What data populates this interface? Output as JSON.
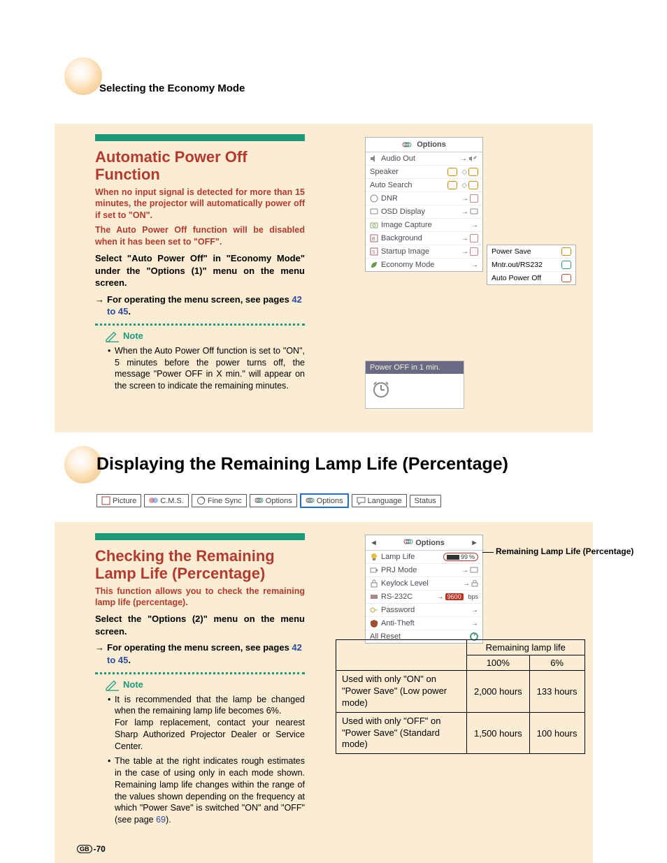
{
  "header": {
    "title": "Selecting the Economy Mode"
  },
  "section1": {
    "heading": "Automatic Power Off Function",
    "red1": "When no input signal is detected for more than 15 minutes, the projector will automatically power off if set to \"ON\".",
    "red2": "The Auto Power Off function will be disabled when it has been set to \"OFF\".",
    "bold": "Select \"Auto Power Off\" in \"Economy Mode\" under the \"Options (1)\" menu on the menu screen.",
    "arrowtext": "For operating the menu screen, see pages ",
    "arrowlink": "42 to 45",
    "arrowtail": ".",
    "note_label": "Note",
    "note_bullet": "When the Auto Power Off function is set to \"ON\", 5 minutes before the power turns off, the message \"Power OFF in X min.\" will appear on the screen to indicate the remaining minutes."
  },
  "osd1": {
    "title": "Options",
    "rows": [
      "Audio Out",
      "Speaker",
      "Auto Search",
      "DNR",
      "OSD Display",
      "Image Capture",
      "Background",
      "Startup Image",
      "Economy Mode"
    ]
  },
  "popout": {
    "rows": [
      "Power Save",
      "Mntr.out/RS232",
      "Auto Power Off"
    ]
  },
  "poweroff_msg": "Power OFF in 1 min.",
  "big_heading": "Displaying the Remaining Lamp Life (Percentage)",
  "tabs": [
    "Picture",
    "C.M.S.",
    "Fine Sync",
    "Options",
    "Options",
    "Language",
    "Status"
  ],
  "section2": {
    "heading": "Checking the Remaining Lamp Life (Percentage)",
    "red": "This function allows you to check the remaining lamp life (percentage).",
    "bold": "Select the \"Options (2)\" menu on the menu screen.",
    "arrowtext": "For operating the menu screen, see pages ",
    "arrowlink": "42 to 45",
    "arrowtail": ".",
    "note_label": "Note",
    "bullet1a": "It is recommended that the lamp be changed when the remaining lamp life becomes 6%.",
    "bullet1b": "For lamp replacement, contact your nearest Sharp Authorized Projector Dealer or Service Center.",
    "bullet2a": "The table at the right indicates rough estimates in the case of using only in each mode shown. Remaining lamp life changes within the range of the values shown depending on the frequency at which \"Power Save\" is switched \"ON\" and \"OFF\" (see page ",
    "bullet2link": "69",
    "bullet2tail": ")."
  },
  "osd2": {
    "title": "Options",
    "lamp_value": "99",
    "lamp_pct": "%",
    "rows": [
      "Lamp Life",
      "PRJ Mode",
      "Keylock Level",
      "RS-232C",
      "Password",
      "Anti-Theft",
      "All Reset"
    ],
    "bps": "9600",
    "bps_label": "bps"
  },
  "callout": "Remaining Lamp Life (Percentage)",
  "table": {
    "head_span": "Remaining lamp life",
    "col1": "100%",
    "col2": "6%",
    "row1_desc": "Used with only \"ON\" on \"Power Save\" (Low power mode)",
    "row1_c1": "2,000 hours",
    "row1_c2": "133 hours",
    "row2_desc": "Used with only \"OFF\" on \"Power Save\" (Standard mode)",
    "row2_c1": "1,500 hours",
    "row2_c2": "100 hours"
  },
  "page_num": {
    "region": "GB",
    "num": "-70"
  }
}
